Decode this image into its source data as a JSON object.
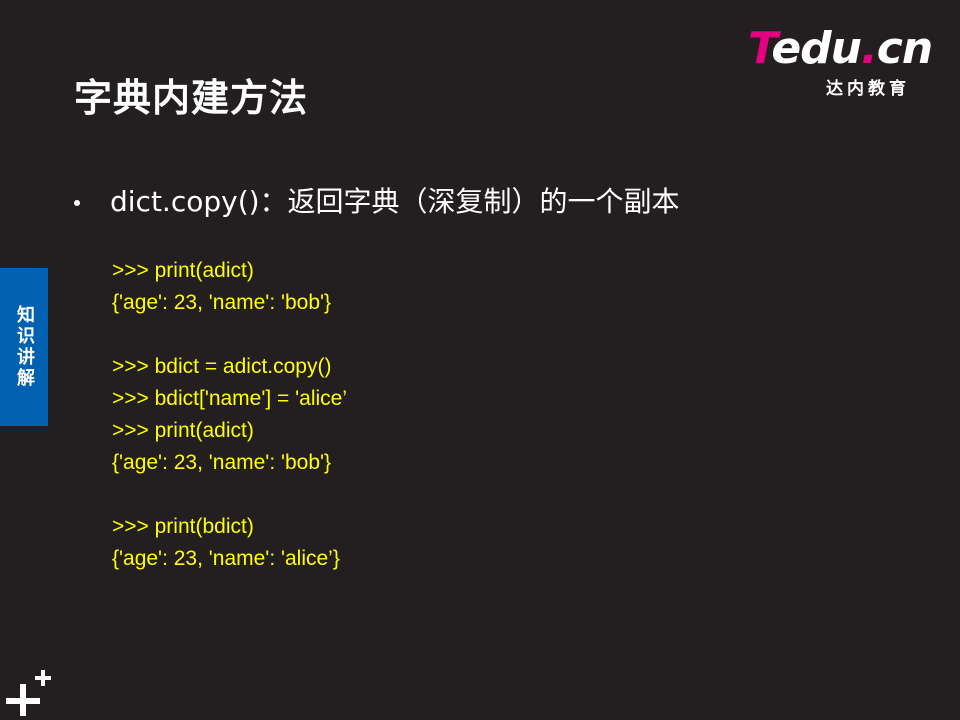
{
  "slide": {
    "title": "字典内建方法",
    "side_tab": "知识讲解"
  },
  "logo": {
    "mark_t": "T",
    "mark_rest": "edu",
    "mark_dot": ".",
    "mark_cn": "cn",
    "subtitle": "达内教育",
    "colors": {
      "magenta": "#e5007f",
      "white": "#ffffff"
    }
  },
  "bullet": {
    "text": "dict.copy()：返回字典（深复制）的一个副本"
  },
  "code_lines": [
    ">>> print(adict)",
    "{'age': 23, 'name': 'bob'}",
    "",
    ">>> bdict = adict.copy()",
    ">>> bdict['name'] = 'alice’",
    ">>> print(adict)",
    "{'age': 23, 'name': 'bob'}",
    "",
    ">>> print(bdict)",
    "{'age': 23, 'name': 'alice’}"
  ],
  "colors": {
    "background": "#231f20",
    "side_tab": "#0061b0",
    "code_text": "#ffff00",
    "body_text": "#ffffff"
  },
  "icons": {
    "bottom_left": "plus-plus-icon"
  }
}
